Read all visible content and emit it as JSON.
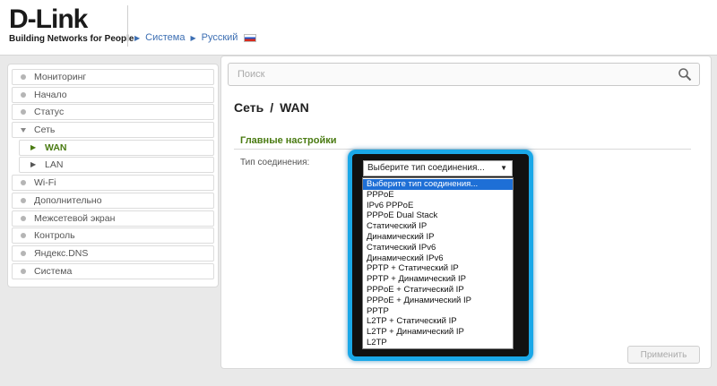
{
  "brand": {
    "logo": "D-Link",
    "tagline": "Building Networks for People"
  },
  "top_nav": {
    "items": [
      "Система",
      "Русский"
    ],
    "flag_icon": "russia-flag-icon"
  },
  "search": {
    "placeholder": "Поиск",
    "icon": "search-icon"
  },
  "sidebar": {
    "items": [
      {
        "label": "Мониторинг"
      },
      {
        "label": "Начало"
      },
      {
        "label": "Статус"
      },
      {
        "label": "Сеть"
      },
      {
        "label": "WAN"
      },
      {
        "label": "LAN"
      },
      {
        "label": "Wi-Fi"
      },
      {
        "label": "Дополнительно"
      },
      {
        "label": "Межсетевой экран"
      },
      {
        "label": "Контроль"
      },
      {
        "label": "Яндекс.DNS"
      },
      {
        "label": "Система"
      }
    ]
  },
  "page": {
    "title_part1": "Сеть",
    "title_separator": "/",
    "title_part2": "WAN",
    "section_title": "Главные настройки",
    "connection_type_label": "Тип соединения:"
  },
  "connection_select": {
    "selected": "Выберите тип соединения...",
    "options": [
      "Выберите тип соединения...",
      "PPPoE",
      "IPv6 PPPoE",
      "PPPoE Dual Stack",
      "Статический IP",
      "Динамический IP",
      "Статический IPv6",
      "Динамический IPv6",
      "PPTP + Статический IP",
      "PPTP + Динамический IP",
      "PPPoE + Статический IP",
      "PPPoE + Динамический IP",
      "PPTP",
      "L2TP + Статический IP",
      "L2TP + Динамический IP",
      "L2TP"
    ]
  },
  "buttons": {
    "apply": "Применить"
  },
  "colors": {
    "accent_green": "#4a7b12",
    "link_blue": "#3d6fb3",
    "highlight_cyan": "#1aa8e8",
    "selected_option": "#1e6fd6"
  }
}
